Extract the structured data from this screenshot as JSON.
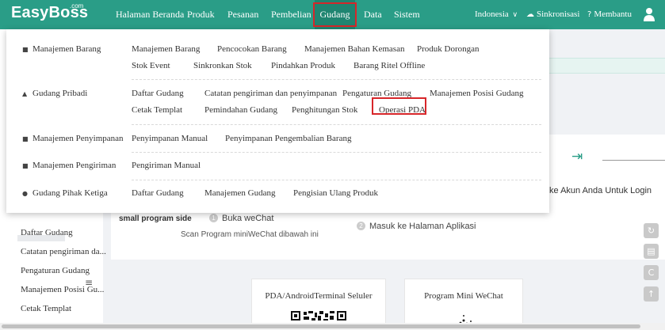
{
  "app": {
    "logo": "EasyBoss",
    "logo_sup": ".com"
  },
  "nav": {
    "items": [
      "Halaman Beranda",
      "Produk",
      "Pesanan",
      "Pembelian",
      "Gudang",
      "Data",
      "Sistem"
    ],
    "active": "Gudang",
    "language": "Indonesia",
    "language_caret": "∨",
    "sync": "Sinkronisasi",
    "help": "Membantu"
  },
  "menu": {
    "sections": [
      {
        "name": "Manajemen Barang",
        "icon": "box-icon",
        "rows": [
          [
            "Manajemen Barang",
            "Pencocokan Barang",
            "Manajemen Bahan Kemasan",
            "Produk Dorongan"
          ],
          [
            "Stok Event",
            "Sinkronkan Stok",
            "Pindahkan Produk",
            "Barang Ritel Offline"
          ]
        ]
      },
      {
        "name": "Gudang Pribadi",
        "icon": "home-icon",
        "rows": [
          [
            "Daftar Gudang",
            "Catatan pengiriman dan penyimpanan",
            "Pengaturan Gudang",
            "Manajemen Posisi Gudang"
          ],
          [
            "Cetak Templat",
            "Pemindahan Gudang",
            "Penghitungan Stok",
            "Operasi PDA"
          ]
        ]
      },
      {
        "name": "Manajemen Penyimpanan",
        "icon": "storage-icon",
        "rows": [
          [
            "Penyimpanan Manual",
            "Penyimpanan Pengembalian Barang"
          ]
        ]
      },
      {
        "name": "Manajemen Pengiriman",
        "icon": "shipping-icon",
        "rows": [
          [
            "Pengiriman Manual"
          ]
        ]
      },
      {
        "name": "Gudang Pihak Ketiga",
        "icon": "third-party-icon",
        "rows": [
          [
            "Daftar Gudang",
            "Manajemen Gudang",
            "Pengisian Ulang Produk"
          ]
        ]
      }
    ],
    "highlighted_item": "Operasi PDA"
  },
  "sidebar": {
    "items": [
      "Daftar Gudang",
      "Catatan pengiriman da...",
      "Pengaturan Gudang",
      "Manajemen Posisi Gu...",
      "Cetak Templat"
    ]
  },
  "content": {
    "small_program_title": "small program side",
    "step1": "Buka weChat",
    "step1_num": "1",
    "step1_sub": "Scan Program miniWeChat dibawah ini",
    "step2": "Masuk ke Halaman Aplikasi",
    "step2_num": "2",
    "login_text": "ke Akun Anda Untuk Login",
    "card1_title": "PDA/AndroidTerminal Seluler",
    "card2_title": "Program Mini WeChat"
  },
  "colors": {
    "brand": "#2a9d87",
    "highlight": "#d7262a"
  }
}
